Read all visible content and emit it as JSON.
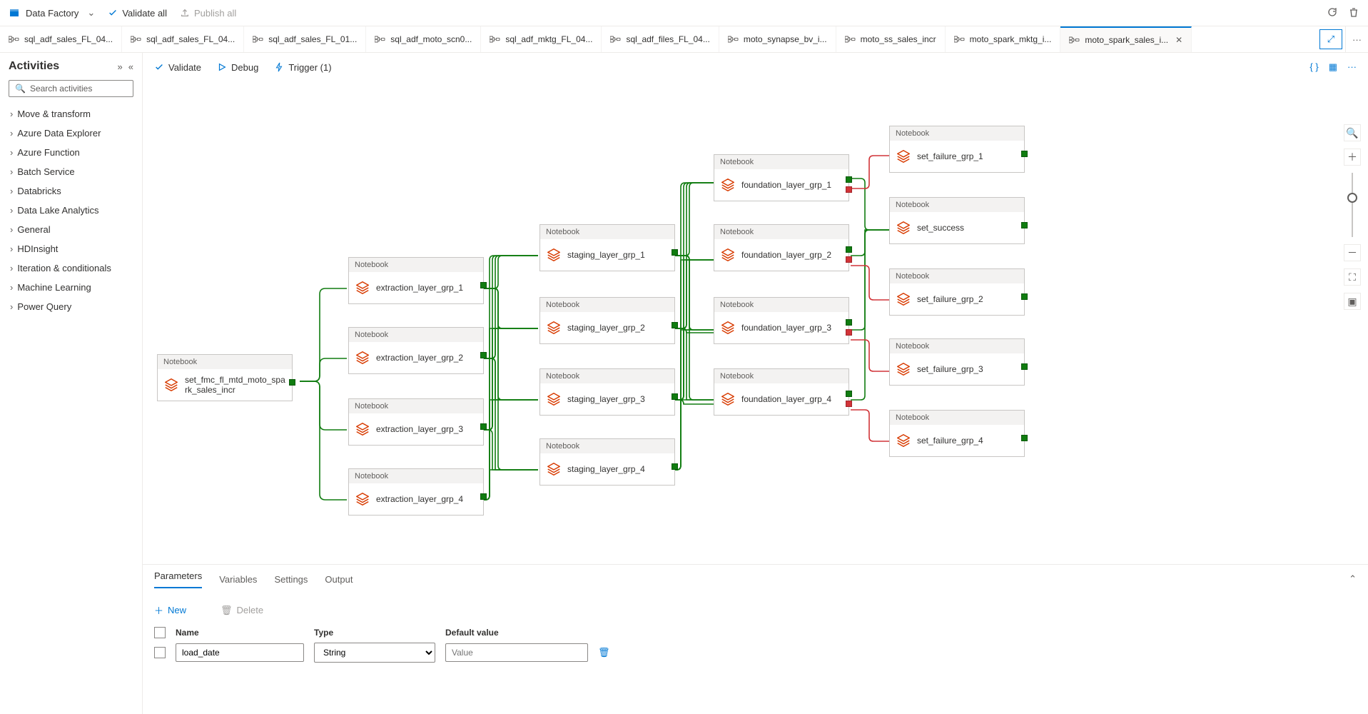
{
  "topbar": {
    "brand": "Data Factory",
    "validate_all": "Validate all",
    "publish_all": "Publish all"
  },
  "tabs": [
    "sql_adf_sales_FL_04...",
    "sql_adf_sales_FL_04...",
    "sql_adf_sales_FL_01...",
    "sql_adf_moto_scn0...",
    "sql_adf_mktg_FL_04...",
    "sql_adf_files_FL_04...",
    "moto_synapse_bv_i...",
    "moto_ss_sales_incr",
    "moto_spark_mktg_i...",
    "moto_spark_sales_i..."
  ],
  "sidebar": {
    "title": "Activities",
    "search_ph": "Search activities",
    "cats": [
      "Move & transform",
      "Azure Data Explorer",
      "Azure Function",
      "Batch Service",
      "Databricks",
      "Data Lake Analytics",
      "General",
      "HDInsight",
      "Iteration & conditionals",
      "Machine Learning",
      "Power Query"
    ]
  },
  "toolbar": {
    "validate": "Validate",
    "debug": "Debug",
    "trigger": "Trigger (1)"
  },
  "node_type": "Notebook",
  "nodes": {
    "root": "set_fmc_fl_mtd_moto_spark_sales_incr",
    "e1": "extraction_layer_grp_1",
    "e2": "extraction_layer_grp_2",
    "e3": "extraction_layer_grp_3",
    "e4": "extraction_layer_grp_4",
    "s1": "staging_layer_grp_1",
    "s2": "staging_layer_grp_2",
    "s3": "staging_layer_grp_3",
    "s4": "staging_layer_grp_4",
    "f1": "foundation_layer_grp_1",
    "f2": "foundation_layer_grp_2",
    "f3": "foundation_layer_grp_3",
    "f4": "foundation_layer_grp_4",
    "x1": "set_failure_grp_1",
    "ok": "set_success",
    "x2": "set_failure_grp_2",
    "x3": "set_failure_grp_3",
    "x4": "set_failure_grp_4"
  },
  "panel": {
    "tabs": [
      "Parameters",
      "Variables",
      "Settings",
      "Output"
    ],
    "new": "New",
    "delete": "Delete",
    "th_name": "Name",
    "th_type": "Type",
    "th_def": "Default value",
    "row_name": "load_date",
    "row_type": "String",
    "row_def_ph": "Value"
  }
}
